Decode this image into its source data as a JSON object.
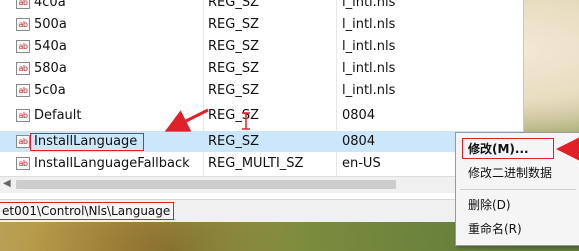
{
  "registry": {
    "rows": [
      {
        "name": "4c0a",
        "type": "REG_SZ",
        "data": "l_intl.nls",
        "selected": false
      },
      {
        "name": "500a",
        "type": "REG_SZ",
        "data": "l_intl.nls",
        "selected": false
      },
      {
        "name": "540a",
        "type": "REG_SZ",
        "data": "l_intl.nls",
        "selected": false
      },
      {
        "name": "580a",
        "type": "REG_SZ",
        "data": "l_intl.nls",
        "selected": false
      },
      {
        "name": "5c0a",
        "type": "REG_SZ",
        "data": "l_intl.nls",
        "selected": false
      },
      {
        "name": "Default",
        "type": "REG_SZ",
        "data": "0804",
        "selected": false
      },
      {
        "name": "InstallLanguage",
        "type": "REG_SZ",
        "data": "0804",
        "selected": true
      },
      {
        "name": "InstallLanguageFallback",
        "type": "REG_MULTI_SZ",
        "data": "en-US",
        "selected": false
      }
    ],
    "value_icon": "ab-string-value-icon",
    "icon_text": "ab"
  },
  "statusbar": {
    "path": "et001\\Control\\Nls\\Language"
  },
  "context_menu": {
    "items": [
      {
        "label": "修改(M)...",
        "bold": true,
        "highlighted": true
      },
      {
        "label": "修改二进制数据",
        "bold": false,
        "highlighted": false
      },
      {
        "label": "删除(D)",
        "bold": false,
        "highlighted": false
      },
      {
        "label": "重命名(R)",
        "bold": false,
        "highlighted": false
      }
    ]
  },
  "colors": {
    "selection": "#cce6fb",
    "annotation_red": "#e0212a"
  }
}
